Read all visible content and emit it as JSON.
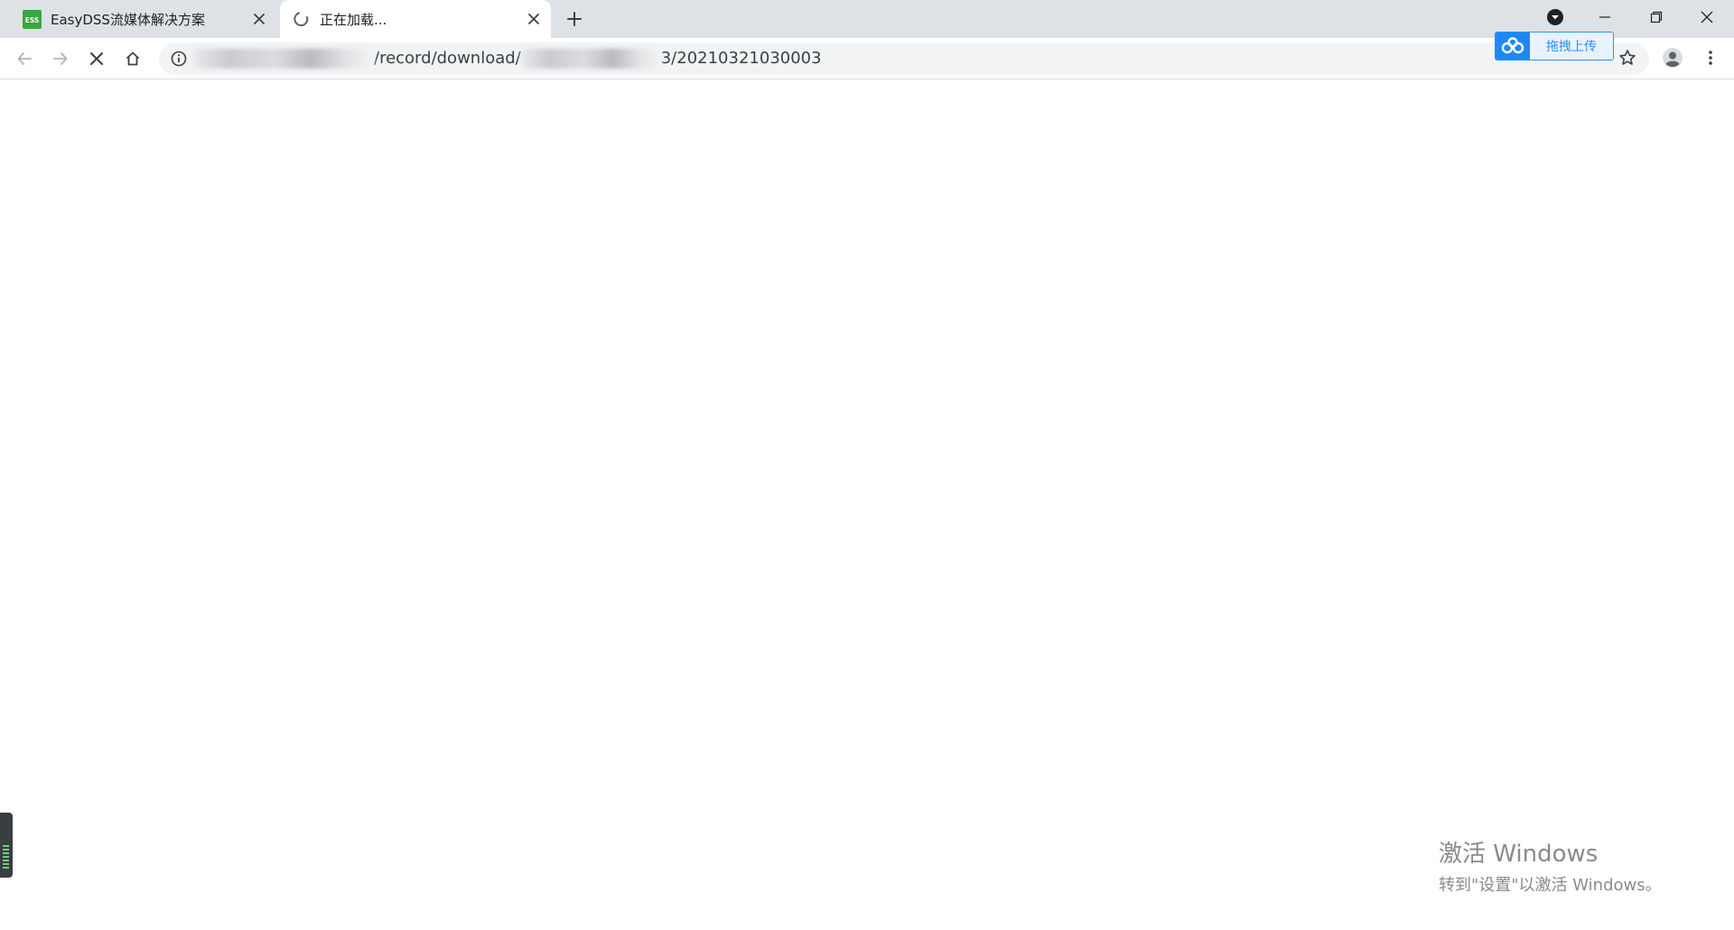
{
  "tabs": [
    {
      "title": "EasyDSS流媒体解决方案",
      "favicon_text": "ESS",
      "favicon_color": "#3aa63e",
      "active": false
    },
    {
      "title": "正在加载...",
      "active": true
    }
  ],
  "omnibox": {
    "url_middle": "/record/download/",
    "url_end": "3/20210321030003"
  },
  "baidu_widget": {
    "label": "拖拽上传",
    "accent": "#1e88f5"
  },
  "watermark": {
    "line1": "激活 Windows",
    "line2": "转到\"设置\"以激活 Windows。"
  },
  "icons": {
    "back": "arrow-left-icon",
    "forward": "arrow-right-icon",
    "stop": "close-icon",
    "home": "home-icon",
    "info": "info-icon",
    "star": "star-icon",
    "profile": "avatar-icon",
    "menu": "kebab-menu-icon",
    "downloads": "chevron-down-circle-icon"
  }
}
